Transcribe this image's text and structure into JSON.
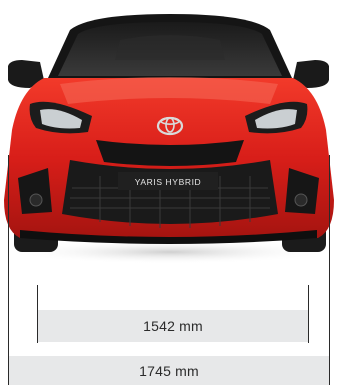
{
  "vehicle": {
    "badge_text": "YARIS HYBRID",
    "body_color": "#d8201c",
    "logo_icon": "toyota-emblem-icon"
  },
  "dimensions": {
    "track_width": "1542 mm",
    "overall_width": "1745 mm"
  }
}
